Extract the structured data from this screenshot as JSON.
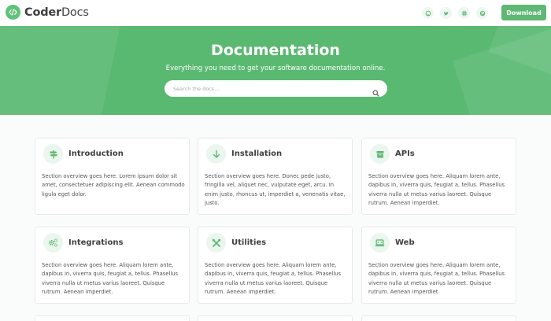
{
  "header": {
    "brand_bold": "Coder",
    "brand_light": "Docs",
    "logo_icon": "code-icon",
    "social": [
      {
        "icon": "github-icon"
      },
      {
        "icon": "twitter-icon"
      },
      {
        "icon": "slack-icon"
      },
      {
        "icon": "product-hunt-icon"
      }
    ],
    "download_label": "Download"
  },
  "hero": {
    "title": "Documentation",
    "subtitle": "Everything you need to get your software documentation online.",
    "search_placeholder": "Search the docs..."
  },
  "colors": {
    "brand": "#5fb873",
    "hero_bg": "#5ab971",
    "icon_bg": "#eaf6ee"
  },
  "sections": [
    {
      "title": "Introduction",
      "icon": "signpost-icon",
      "text": "Section overview goes here. Lorem ipsum dolor sit amet, consectetuer adipiscing elit. Aenean commodo ligula eget dolor."
    },
    {
      "title": "Installation",
      "icon": "arrow-down-icon",
      "text": "Section overview goes here. Donec pede justo, fringilla vel, aliquet nec, vulputate eget, arcu. In enim justo, rhoncus ut, imperdiet a, venenatis vitae, justo."
    },
    {
      "title": "APIs",
      "icon": "box-icon",
      "text": "Section overview goes here. Aliquam lorem ante, dapibus in, viverra quis, feugiat a, tellus. Phasellus viverra nulla ut metus varius laoreet. Quisque rutrum. Aenean imperdiet."
    },
    {
      "title": "Integrations",
      "icon": "cogs-icon",
      "text": "Section overview goes here. Aliquam lorem ante, dapibus in, viverra quis, feugiat a, tellus. Phasellus viverra nulla ut metus varius laoreet. Quisque rutrum. Aenean imperdiet."
    },
    {
      "title": "Utilities",
      "icon": "tools-icon",
      "text": "Section overview goes here. Aliquam lorem ante, dapibus in, viverra quis, feugiat a, tellus. Phasellus viverra nulla ut metus varius laoreet. Quisque rutrum. Aenean imperdiet."
    },
    {
      "title": "Web",
      "icon": "laptop-code-icon",
      "text": "Section overview goes here. Aliquam lorem ante, dapibus in, viverra quis, feugiat a, tellus. Phasellus viverra nulla ut metus varius laoreet. Quisque rutrum. Aenean imperdiet."
    }
  ]
}
